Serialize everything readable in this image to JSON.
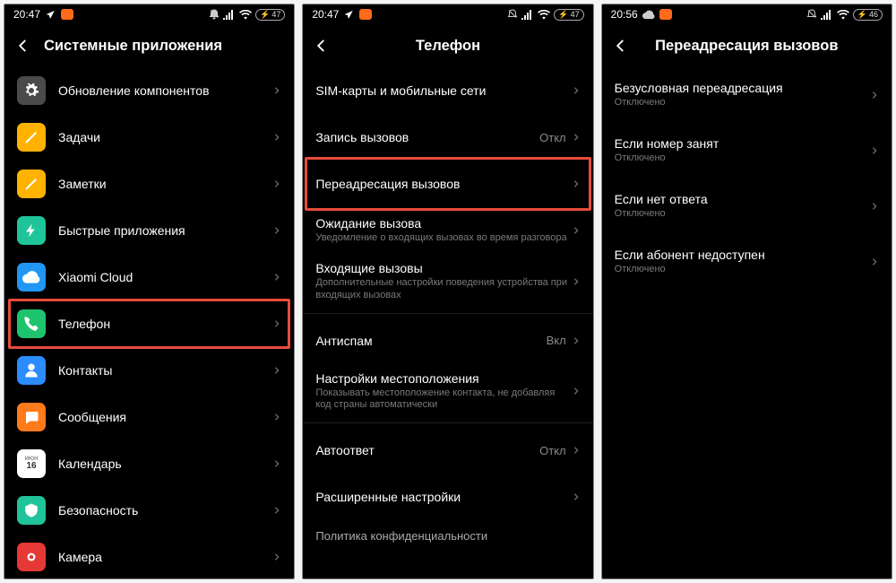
{
  "status": {
    "time_a": "20:47",
    "time_b": "20:47",
    "time_c": "20:56",
    "battery_a": "47",
    "battery_b": "47",
    "battery_c": "46"
  },
  "screen1": {
    "title": "Системные приложения",
    "items": [
      {
        "label": "Обновление компонентов",
        "icon": "gear",
        "bg": "#4a4a4a"
      },
      {
        "label": "Задачи",
        "icon": "note",
        "bg": "#ffb300"
      },
      {
        "label": "Заметки",
        "icon": "note",
        "bg": "#ffb300"
      },
      {
        "label": "Быстрые приложения",
        "icon": "bolt",
        "bg": "#1fc49a"
      },
      {
        "label": "Xiaomi Cloud",
        "icon": "cloud",
        "bg": "#2196f3"
      },
      {
        "label": "Телефон",
        "icon": "phone",
        "bg": "#1ec36e",
        "highlight": true
      },
      {
        "label": "Контакты",
        "icon": "person",
        "bg": "#2a8cff"
      },
      {
        "label": "Сообщения",
        "icon": "chat",
        "bg": "#ff7a1a"
      },
      {
        "label": "Календарь",
        "icon": "cal",
        "bg": "#ffffff"
      },
      {
        "label": "Безопасность",
        "icon": "shield",
        "bg": "#1fc49a"
      },
      {
        "label": "Камера",
        "icon": "cam",
        "bg": "#e53935"
      }
    ],
    "cal_text": "16"
  },
  "screen2": {
    "title": "Телефон",
    "items": [
      {
        "label": "SIM-карты и мобильные сети"
      },
      {
        "label": "Запись вызовов",
        "value": "Откл"
      },
      {
        "label": "Переадресация вызовов",
        "highlight": true
      },
      {
        "label": "Ожидание вызова",
        "sub": "Уведомление о входящих вызовах во время разговора"
      },
      {
        "label": "Входящие вызовы",
        "sub": "Дополнительные настройки поведения устройства при входящих вызовах"
      },
      {
        "label": "Антиспам",
        "value": "Вкл"
      },
      {
        "label": "Настройки местоположения",
        "sub": "Показывать местоположение контакта, не добавляя код страны автоматически"
      },
      {
        "label": "Автоответ",
        "value": "Откл"
      },
      {
        "label": "Расширенные настройки"
      }
    ],
    "footer": "Политика конфиденциальности"
  },
  "screen3": {
    "title": "Переадресация вызовов",
    "items": [
      {
        "label": "Безусловная переадресация",
        "sub": "Отключено"
      },
      {
        "label": "Если номер занят",
        "sub": "Отключено"
      },
      {
        "label": "Если нет ответа",
        "sub": "Отключено"
      },
      {
        "label": "Если абонент недоступен",
        "sub": "Отключено"
      }
    ]
  }
}
